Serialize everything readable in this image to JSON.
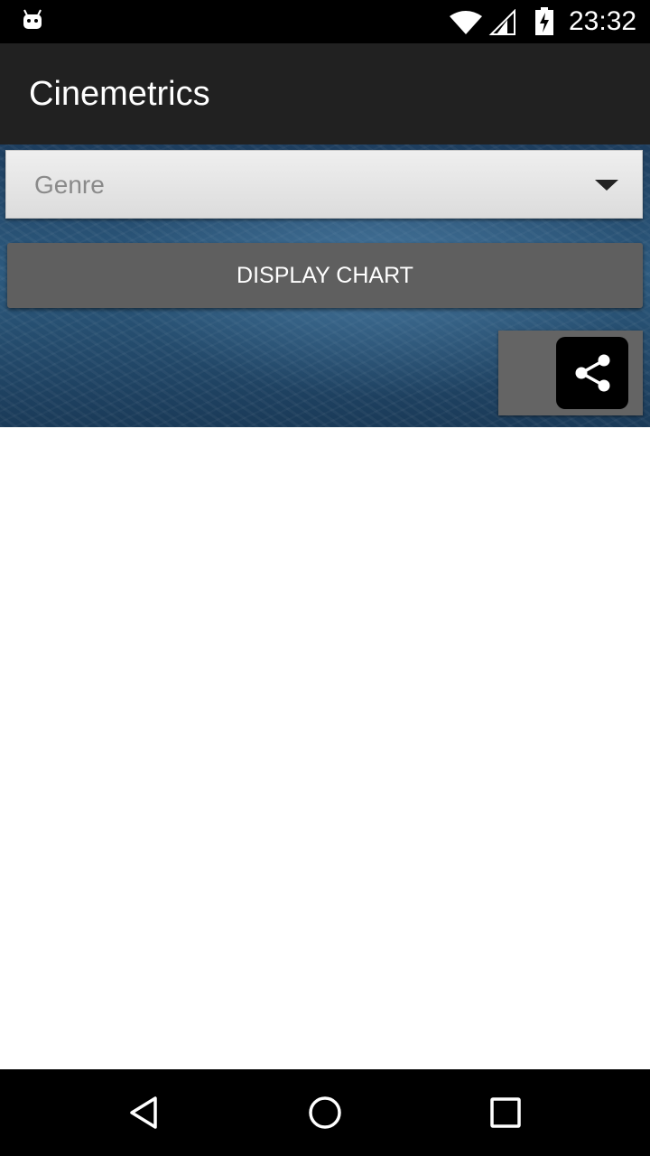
{
  "status_bar": {
    "time": "23:32",
    "icons": [
      "android-icon",
      "wifi-icon",
      "signal-icon",
      "battery-icon"
    ]
  },
  "app_bar": {
    "title": "Cinemetrics"
  },
  "form": {
    "genre_spinner_label": "Genre",
    "display_chart_label": "DISPLAY CHART"
  },
  "share": {
    "icon": "share-icon"
  },
  "nav_bar": {
    "buttons": [
      "back-icon",
      "home-icon",
      "recent-apps-icon"
    ]
  },
  "colors": {
    "app_bar_bg": "#212121",
    "button_bg": "#5f5f5f",
    "spinner_bg": "#e6e6e6",
    "hero_bg": "#2d5a7e"
  }
}
